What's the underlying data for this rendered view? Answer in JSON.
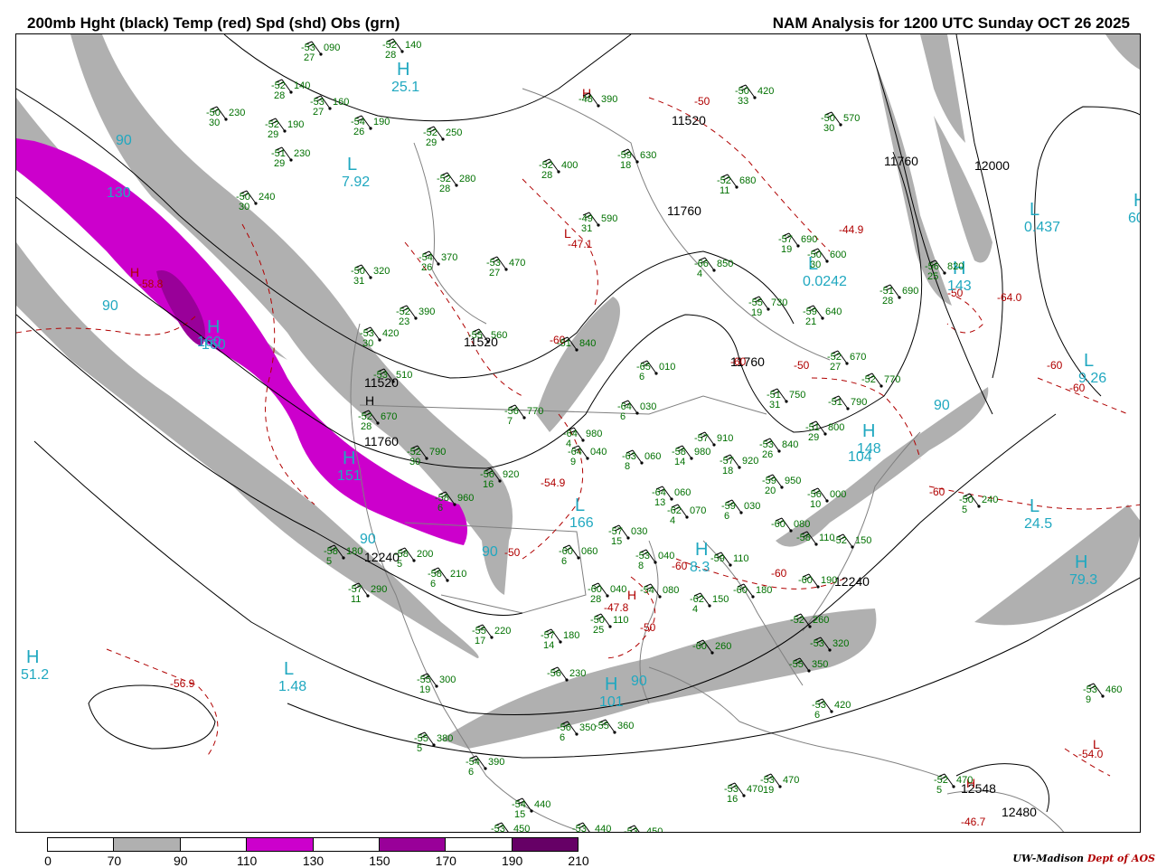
{
  "header": {
    "title_left": "200mb Hght (black) Temp (red) Spd (shd) Obs (grn)",
    "title_right": "NAM Analysis for 1200 UTC Sunday  OCT 26 2025"
  },
  "colors": {
    "height_contour": "#000000",
    "temp_contour": "#b00000",
    "obs": "#007000",
    "speed_label": "#20a8c0",
    "geography": "#808080",
    "shade_70": "#b0b0b0",
    "shade_110": "#cc00cc",
    "shade_150": "#990099",
    "shade_190": "#660066"
  },
  "legend": {
    "ticks": [
      "0",
      "70",
      "90",
      "110",
      "130",
      "150",
      "170",
      "190",
      "210"
    ],
    "fills": [
      "#ffffff",
      "#b0b0b0",
      "#ffffff",
      "#cc00cc",
      "#ffffff",
      "#990099",
      "#ffffff",
      "#660066"
    ]
  },
  "height_labels": [
    "11520",
    "11760",
    "12000",
    "11520",
    "11760",
    "11760",
    "11520",
    "11760",
    "12240",
    "12240",
    "12548",
    "12480"
  ],
  "temp_labels": [
    "-58.8",
    "-47.1",
    "-44.9",
    "-64.0",
    "-60",
    "-50",
    "-54.9",
    "-47.8",
    "-56.9",
    "-54.0",
    "-46.7",
    "-60",
    "-50",
    "-60",
    "-50",
    "-60",
    "-50",
    "-60",
    "-60",
    "-50",
    "-60"
  ],
  "speed_labels": [
    "90",
    "130",
    "90",
    "160",
    "90",
    "90",
    "90",
    "104",
    "90"
  ],
  "extrema": [
    {
      "letter": "H",
      "value": "25.1",
      "kind": "speed"
    },
    {
      "letter": "L",
      "value": "7.92",
      "kind": "speed"
    },
    {
      "letter": "H",
      "value": "160",
      "kind": "speed"
    },
    {
      "letter": "H",
      "value": "151",
      "kind": "speed"
    },
    {
      "letter": "L",
      "value": "1.48",
      "kind": "speed"
    },
    {
      "letter": "H",
      "value": "51.2",
      "kind": "speed"
    },
    {
      "letter": "L",
      "value": "166",
      "kind": "speed"
    },
    {
      "letter": "H",
      "value": "101",
      "kind": "speed"
    },
    {
      "letter": "H",
      "value": "8.3",
      "kind": "speed"
    },
    {
      "letter": "L",
      "value": "0.437",
      "kind": "speed"
    },
    {
      "letter": "H",
      "value": "60.",
      "kind": "speed"
    },
    {
      "letter": "L",
      "value": "0.0242",
      "kind": "speed"
    },
    {
      "letter": "L",
      "value": "9.26",
      "kind": "speed"
    },
    {
      "letter": "L",
      "value": "24.5",
      "kind": "speed"
    },
    {
      "letter": "H",
      "value": "79.3",
      "kind": "speed"
    },
    {
      "letter": "H",
      "value": "143",
      "kind": "speed"
    },
    {
      "letter": "H",
      "value": "148",
      "kind": "speed"
    },
    {
      "letter": "H",
      "value": "",
      "kind": "temp"
    },
    {
      "letter": "L",
      "value": "",
      "kind": "temp"
    },
    {
      "letter": "H",
      "value": "",
      "kind": "temp"
    },
    {
      "letter": "H",
      "value": "",
      "kind": "height"
    },
    {
      "letter": "H",
      "value": "",
      "kind": "temp"
    },
    {
      "letter": "L",
      "value": "",
      "kind": "temp"
    },
    {
      "letter": "H",
      "value": "",
      "kind": "temp"
    }
  ],
  "observations": [
    {
      "t": "-53",
      "h": "090",
      "d": "27"
    },
    {
      "t": "-52",
      "h": "140",
      "d": "28"
    },
    {
      "t": "-52",
      "h": "140",
      "d": "28"
    },
    {
      "t": "-53",
      "h": "160",
      "d": "27"
    },
    {
      "t": "-50",
      "h": "230",
      "d": "30"
    },
    {
      "t": "-52",
      "h": "190",
      "d": "29"
    },
    {
      "t": "-54",
      "h": "190",
      "d": "26"
    },
    {
      "t": "-51",
      "h": "230",
      "d": "29"
    },
    {
      "t": "-52",
      "h": "250",
      "d": "29"
    },
    {
      "t": "-52",
      "h": "400",
      "d": "28"
    },
    {
      "t": "-52",
      "h": "280",
      "d": "28"
    },
    {
      "t": "-50",
      "h": "240",
      "d": "30"
    },
    {
      "t": "-48",
      "h": "390",
      "d": ""
    },
    {
      "t": "-50",
      "h": "420",
      "d": "33"
    },
    {
      "t": "-50",
      "h": "570",
      "d": "30"
    },
    {
      "t": "-59",
      "h": "630",
      "d": "18"
    },
    {
      "t": "-52",
      "h": "680",
      "d": "11"
    },
    {
      "t": "-49",
      "h": "590",
      "d": "31"
    },
    {
      "t": "-57",
      "h": "690",
      "d": "19"
    },
    {
      "t": "-50",
      "h": "600",
      "d": "30"
    },
    {
      "t": "-54",
      "h": "370",
      "d": "26"
    },
    {
      "t": "-53",
      "h": "470",
      "d": "27"
    },
    {
      "t": "-50",
      "h": "320",
      "d": "31"
    },
    {
      "t": "-66",
      "h": "850",
      "d": "4"
    },
    {
      "t": "-52",
      "h": "390",
      "d": "23"
    },
    {
      "t": "-55",
      "h": "730",
      "d": "19"
    },
    {
      "t": "-59",
      "h": "640",
      "d": "21"
    },
    {
      "t": "-51",
      "h": "690",
      "d": "28"
    },
    {
      "t": "-56",
      "h": "820",
      "d": "25"
    },
    {
      "t": "-53",
      "h": "420",
      "d": "30"
    },
    {
      "t": "-55",
      "h": "560",
      "d": ""
    },
    {
      "t": "-51",
      "h": "840",
      "d": ""
    },
    {
      "t": "-52",
      "h": "670",
      "d": "27"
    },
    {
      "t": "-65",
      "h": "010",
      "d": "6"
    },
    {
      "t": "-53",
      "h": "510",
      "d": ""
    },
    {
      "t": "-52",
      "h": "770",
      "d": ""
    },
    {
      "t": "-51",
      "h": "750",
      "d": "31"
    },
    {
      "t": "-51",
      "h": "790",
      "d": ""
    },
    {
      "t": "-64",
      "h": "030",
      "d": "6"
    },
    {
      "t": "-56",
      "h": "770",
      "d": "7"
    },
    {
      "t": "-52",
      "h": "670",
      "d": "28"
    },
    {
      "t": "-64",
      "h": "980",
      "d": "4"
    },
    {
      "t": "-51",
      "h": "800",
      "d": "29"
    },
    {
      "t": "-57",
      "h": "910",
      "d": ""
    },
    {
      "t": "-53",
      "h": "840",
      "d": "26"
    },
    {
      "t": "-64",
      "h": "040",
      "d": "9"
    },
    {
      "t": "-63",
      "h": "060",
      "d": "8"
    },
    {
      "t": "-58",
      "h": "980",
      "d": "14"
    },
    {
      "t": "-52",
      "h": "790",
      "d": "30"
    },
    {
      "t": "-56",
      "h": "920",
      "d": "16"
    },
    {
      "t": "-57",
      "h": "920",
      "d": "18"
    },
    {
      "t": "-59",
      "h": "950",
      "d": "20"
    },
    {
      "t": "-56",
      "h": "000",
      "d": "10"
    },
    {
      "t": "-58",
      "h": "960",
      "d": "6"
    },
    {
      "t": "-64",
      "h": "060",
      "d": "13"
    },
    {
      "t": "-62",
      "h": "070",
      "d": "4"
    },
    {
      "t": "-59",
      "h": "030",
      "d": "6"
    },
    {
      "t": "-60",
      "h": "080",
      "d": ""
    },
    {
      "t": "-58",
      "h": "110",
      "d": ""
    },
    {
      "t": "-52",
      "h": "150",
      "d": ""
    },
    {
      "t": "-50",
      "h": "240",
      "d": "5"
    },
    {
      "t": "-58",
      "h": "180",
      "d": "5"
    },
    {
      "t": "-58",
      "h": "200",
      "d": "5"
    },
    {
      "t": "-57",
      "h": "030",
      "d": "15"
    },
    {
      "t": "-60",
      "h": "060",
      "d": "6"
    },
    {
      "t": "-53",
      "h": "040",
      "d": "8"
    },
    {
      "t": "-58",
      "h": "210",
      "d": "6"
    },
    {
      "t": "-59",
      "h": "110",
      "d": ""
    },
    {
      "t": "-60",
      "h": "190",
      "d": ""
    },
    {
      "t": "-57",
      "h": "290",
      "d": "11"
    },
    {
      "t": "-60",
      "h": "040",
      "d": "28"
    },
    {
      "t": "-54",
      "h": "080",
      "d": ""
    },
    {
      "t": "-60",
      "h": "180",
      "d": ""
    },
    {
      "t": "-62",
      "h": "150",
      "d": "4"
    },
    {
      "t": "-50",
      "h": "110",
      "d": "25"
    },
    {
      "t": "-55",
      "h": "220",
      "d": "17"
    },
    {
      "t": "-57",
      "h": "180",
      "d": "14"
    },
    {
      "t": "-52",
      "h": "260",
      "d": ""
    },
    {
      "t": "-60",
      "h": "260",
      "d": ""
    },
    {
      "t": "-53",
      "h": "320",
      "d": ""
    },
    {
      "t": "-56",
      "h": "230",
      "d": ""
    },
    {
      "t": "-55",
      "h": "350",
      "d": ""
    },
    {
      "t": "-55",
      "h": "300",
      "d": "19"
    },
    {
      "t": "-53",
      "h": "460",
      "d": "9"
    },
    {
      "t": "-53",
      "h": "420",
      "d": "6"
    },
    {
      "t": "-56",
      "h": "350",
      "d": "6"
    },
    {
      "t": "-55",
      "h": "360",
      "d": ""
    },
    {
      "t": "-55",
      "h": "380",
      "d": "5"
    },
    {
      "t": "-54",
      "h": "390",
      "d": "6"
    },
    {
      "t": "-53",
      "h": "470",
      "d": "19"
    },
    {
      "t": "-53",
      "h": "470",
      "d": "16"
    },
    {
      "t": "-52",
      "h": "470",
      "d": "5"
    },
    {
      "t": "-54",
      "h": "440",
      "d": "15"
    },
    {
      "t": "-53",
      "h": "450",
      "d": ""
    },
    {
      "t": "-53",
      "h": "440",
      "d": ""
    },
    {
      "t": "-53",
      "h": "450",
      "d": ""
    }
  ],
  "credit": {
    "org": "UW-Madison",
    "dept": "Dept of AOS"
  }
}
